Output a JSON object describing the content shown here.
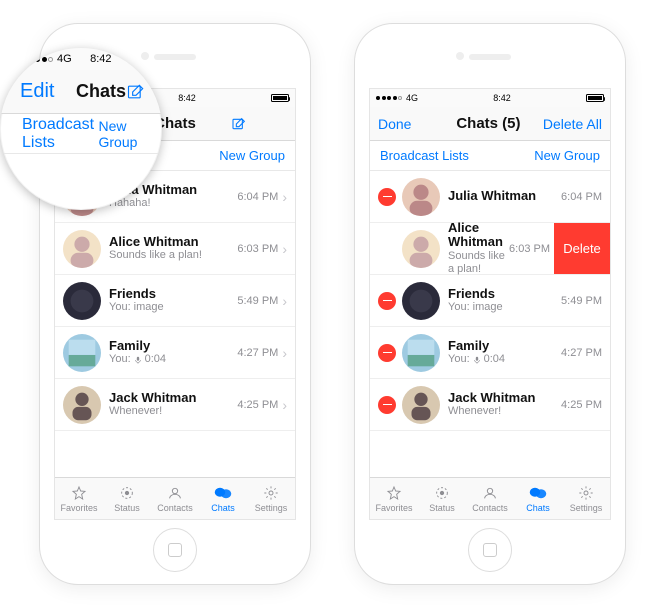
{
  "colors": {
    "accent": "#007aff",
    "danger": "#ff3b30",
    "muted": "#8e8e93"
  },
  "status": {
    "carrier": "4G",
    "time": "8:42"
  },
  "left": {
    "nav": {
      "left": "Edit",
      "title": "Chats",
      "compose": "compose"
    },
    "sub": {
      "left": "Broadcast Lists",
      "right": "New Group"
    },
    "chats": [
      {
        "name": "Julia Whitman",
        "preview": "Hahaha!",
        "time": "6:04 PM"
      },
      {
        "name": "Alice Whitman",
        "preview": "Sounds like a plan!",
        "time": "6:03 PM"
      },
      {
        "name": "Friends",
        "preview_prefix": "You:",
        "preview": "image",
        "time": "5:49 PM"
      },
      {
        "name": "Family",
        "preview_prefix": "You:",
        "voice": "0:04",
        "time": "4:27 PM"
      },
      {
        "name": "Jack Whitman",
        "preview": "Whenever!",
        "time": "4:25 PM"
      }
    ]
  },
  "right": {
    "nav": {
      "left": "Done",
      "title": "Chats (5)",
      "right": "Delete All"
    },
    "sub": {
      "left": "Broadcast Lists",
      "right": "New Group"
    },
    "swipe_delete_label": "Delete",
    "chats": [
      {
        "name": "Julia Whitman",
        "preview": "",
        "time": "6:04 PM",
        "minus": true
      },
      {
        "name": "Alice Whitman",
        "preview": "Sounds like a plan!",
        "time": "6:03 PM",
        "swiped": true
      },
      {
        "name": "Friends",
        "preview_prefix": "You:",
        "preview": "image",
        "time": "5:49 PM",
        "minus": true
      },
      {
        "name": "Family",
        "preview_prefix": "You:",
        "voice": "0:04",
        "time": "4:27 PM",
        "minus": true
      },
      {
        "name": "Jack Whitman",
        "preview": "Whenever!",
        "time": "4:25 PM",
        "minus": true
      }
    ]
  },
  "tabs": [
    {
      "label": "Favorites",
      "icon": "star"
    },
    {
      "label": "Status",
      "icon": "status"
    },
    {
      "label": "Contacts",
      "icon": "contacts"
    },
    {
      "label": "Chats",
      "icon": "chats",
      "active": true
    },
    {
      "label": "Settings",
      "icon": "settings"
    }
  ],
  "lens": {
    "nav_left": "Edit",
    "nav_title": "Chats",
    "sub_left": "Broadcast Lists",
    "sub_right": "New Group"
  }
}
